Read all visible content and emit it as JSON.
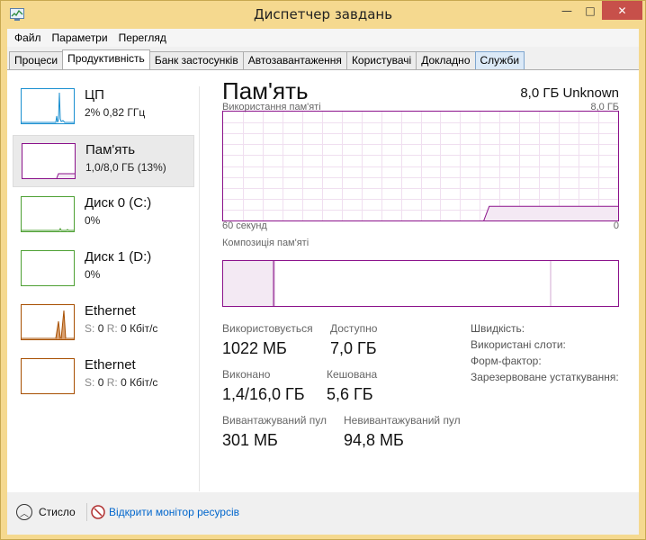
{
  "window": {
    "title": "Диспетчер завдань",
    "minimize": "—",
    "maximize": "□",
    "close": "✕"
  },
  "menu": [
    "Файл",
    "Параметри",
    "Перегляд"
  ],
  "tabs": [
    {
      "label": "Процеси",
      "active": false
    },
    {
      "label": "Продуктивність",
      "active": true
    },
    {
      "label": "Банк застосунків",
      "active": false
    },
    {
      "label": "Автозавантаження",
      "active": false
    },
    {
      "label": "Користувачі",
      "active": false
    },
    {
      "label": "Докладно",
      "active": false
    },
    {
      "label": "Служби",
      "active": false
    }
  ],
  "sidebar": {
    "items": [
      {
        "name": "ЦП",
        "sub": "2% 0,82 ГГц",
        "color": "#1a8fd0",
        "selected": false
      },
      {
        "name": "Пам'ять",
        "sub": "1,0/8,0 ГБ (13%)",
        "color": "#8b128b",
        "selected": true
      },
      {
        "name": "Диск 0 (C:)",
        "sub": "0%",
        "color": "#4da033",
        "selected": false
      },
      {
        "name": "Диск 1 (D:)",
        "sub": "0%",
        "color": "#4da033",
        "selected": false
      },
      {
        "name": "Ethernet",
        "sub_s_label": "S:",
        "sub_s": "0",
        "sub_r_label": "R:",
        "sub_r": "0 Кбіт/с",
        "color": "#a74f01",
        "selected": false
      },
      {
        "name": "Ethernet",
        "sub_s_label": "S:",
        "sub_s": "0",
        "sub_r_label": "R:",
        "sub_r": "0 Кбіт/с",
        "color": "#a74f01",
        "selected": false
      }
    ]
  },
  "main": {
    "title": "Пам'ять",
    "total": "8,0 ГБ Unknown",
    "usage_label": "Використання пам'яті",
    "usage_max": "8,0 ГБ",
    "time_label": "60 секунд",
    "time_min": "0",
    "usage_fraction": 0.13,
    "composition_label": "Композиція пам'яті",
    "stats": {
      "in_use_label": "Використовується",
      "in_use": "1022 МБ",
      "available_label": "Доступно",
      "available": "7,0 ГБ",
      "committed_label": "Виконано",
      "committed": "1,4/16,0 ГБ",
      "cached_label": "Кешована",
      "cached": "5,6 ГБ",
      "paged_label": "Вивантажуваний пул",
      "paged": "301 МБ",
      "nonpaged_label": "Невивантажуваний пул",
      "nonpaged": "94,8 МБ"
    },
    "details": [
      "Швидкість:",
      "Використані слоти:",
      "Форм-фактор:",
      "Зарезервоване устаткування:"
    ]
  },
  "footer": {
    "fewer_details": "Стисло",
    "resource_monitor": "Відкрити монітор ресурсів"
  },
  "colors": {
    "memory": "#8b128b",
    "cpu": "#1a8fd0",
    "disk": "#4da033",
    "ethernet": "#a74f01",
    "link": "#0066cc"
  }
}
